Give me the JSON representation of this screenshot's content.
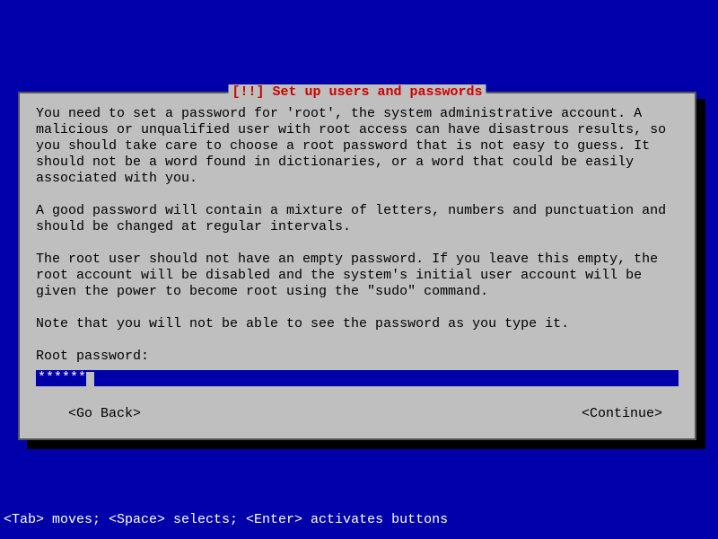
{
  "dialog": {
    "title": "[!!] Set up users and passwords",
    "para1": "You need to set a password for 'root', the system administrative account. A malicious or unqualified user with root access can have disastrous results, so you should take care to choose a root password that is not easy to guess. It should not be a word found in dictionaries, or a word that could be easily associated with you.",
    "para2": "A good password will contain a mixture of letters, numbers and punctuation and should be changed at regular intervals.",
    "para3": "The root user should not have an empty password. If you leave this empty, the root account will be disabled and the system's initial user account will be given the power to become root using the \"sudo\" command.",
    "para4": "Note that you will not be able to see the password as you type it.",
    "prompt_label": "Root password:",
    "password_masked": "******",
    "go_back_label": "<Go Back>",
    "continue_label": "<Continue>"
  },
  "help_line": "<Tab> moves; <Space> selects; <Enter> activates buttons"
}
